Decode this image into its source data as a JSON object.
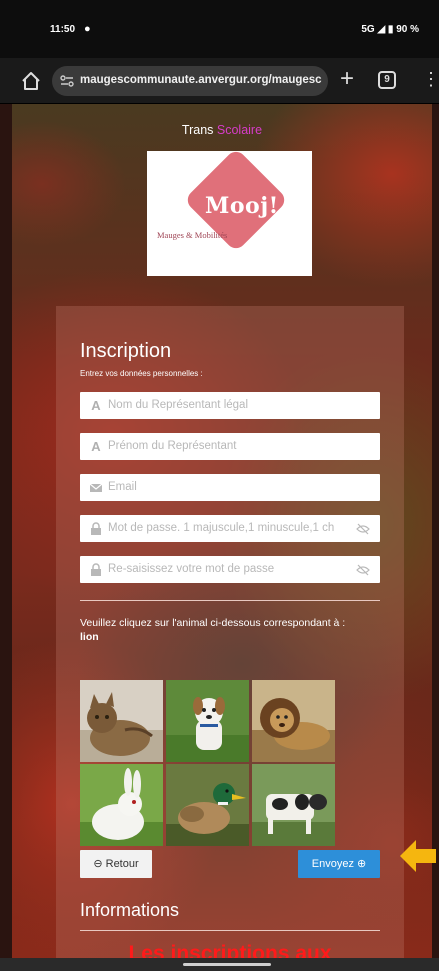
{
  "status_bar": {
    "time": "11:50",
    "right": "5G ◢ ▮ 90 %"
  },
  "browser": {
    "url": "maugescommunaute.anvergur.org/maugesc",
    "tab_count": "9",
    "icons": [
      "home-icon",
      "site-settings-icon",
      "new-tab-icon",
      "tabs-icon",
      "menu-icon"
    ]
  },
  "header": {
    "title_part1": "Trans ",
    "title_part2": "Scolaire",
    "accent_color": "#d63cc9"
  },
  "logo": {
    "wordmark": "Mooj!",
    "tagline": "Mauges & Mobilités",
    "color": "#e0707a"
  },
  "form": {
    "title": "Inscription",
    "subtitle": "Entrez vos données personnelles :",
    "fields": [
      {
        "placeholder": "Nom du Représentant légal",
        "icon": "text-icon"
      },
      {
        "placeholder": "Prénom du Représentant",
        "icon": "text-icon"
      },
      {
        "placeholder": "Email",
        "icon": "mail-icon"
      },
      {
        "placeholder": "Mot de passe. 1 majuscule,1 minuscule,1 ch",
        "icon": "lock-icon"
      },
      {
        "placeholder": "Re-saisissez votre mot de passe",
        "icon": "lock-icon"
      }
    ],
    "captcha_prompt": "Veuillez cliquez sur l'animal ci-dessous correspondant à :",
    "captcha_answer": "lion",
    "animals": [
      "cat",
      "dog",
      "lion",
      "rabbit",
      "duck",
      "cow"
    ],
    "back_label": "Retour",
    "submit_label": "Envoyez",
    "submit_color": "#2d8fd9"
  },
  "info": {
    "title": "Informations",
    "notice": "Les inscriptions aux",
    "notice_color": "#ff1a1a"
  }
}
